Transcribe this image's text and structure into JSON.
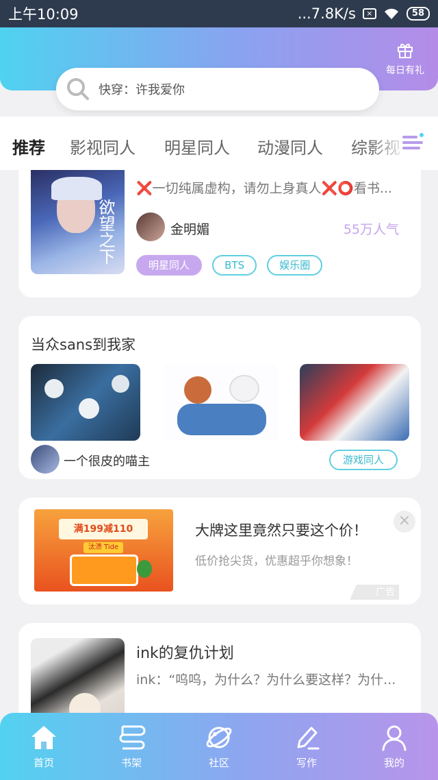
{
  "status_bar": {
    "time": "上午10:09",
    "network_speed": "...7.8K/s",
    "battery": "58"
  },
  "header": {
    "gift_label": "每日有礼",
    "search_placeholder": "快穿：许我爱你"
  },
  "tabs": [
    {
      "label": "推荐",
      "active": true
    },
    {
      "label": "影视同人",
      "active": false
    },
    {
      "label": "明星同人",
      "active": false
    },
    {
      "label": "动漫同人",
      "active": false
    },
    {
      "label": "综影视",
      "active": false
    }
  ],
  "card1": {
    "description": "❌一切纯属虚构，请勿上身真人❌⭕看书...",
    "author": "金明媚",
    "popularity": "55万人气",
    "tags": [
      "明星同人",
      "BTS",
      "娱乐圈"
    ],
    "cover_text": "欲望之下"
  },
  "card2": {
    "title": "当众sans到我家",
    "author": "一个很皮的喵主",
    "tag": "游戏同人"
  },
  "ad": {
    "title": "大牌这里竟然只要这个价！",
    "subtitle": "低价抢尖货，优惠超乎你想象！",
    "badge": "广告",
    "image_text": "满199减110",
    "image_subtext": "汰渍 Tide"
  },
  "card3": {
    "title": "ink的复仇计划",
    "description": "ink：“呜呜，为什么？为什么要这样？为什..."
  },
  "bottom_nav": [
    {
      "label": "首页"
    },
    {
      "label": "书架"
    },
    {
      "label": "社区"
    },
    {
      "label": "写作"
    },
    {
      "label": "我的"
    }
  ],
  "colors": {
    "accent_purple": "#b79be9",
    "accent_cyan": "#38b9cf",
    "gradient_start": "#4fd2f0",
    "gradient_end": "#b48ce8"
  }
}
